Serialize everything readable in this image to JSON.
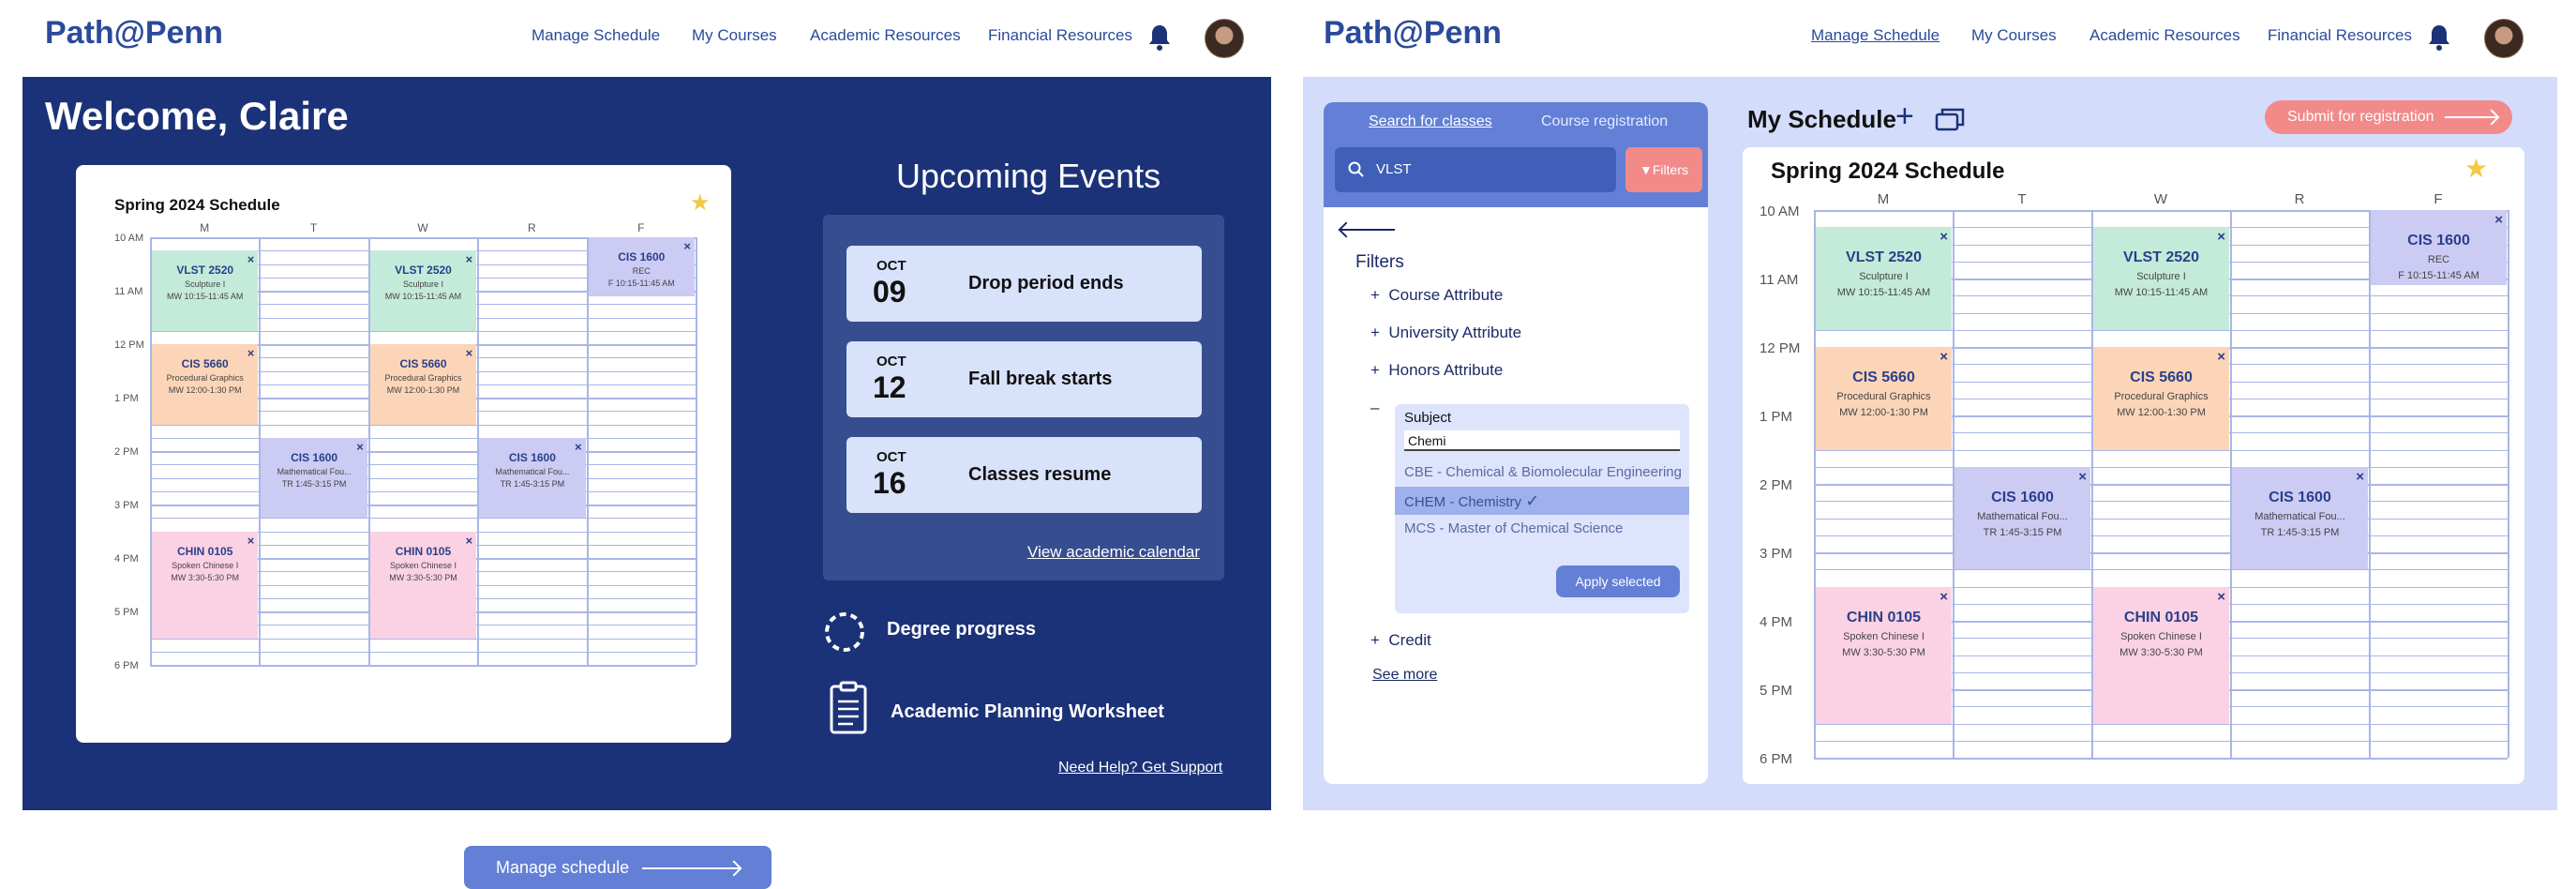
{
  "colors": {
    "navy": "#1c3278",
    "brand": "#2a4a9c",
    "lightblue": "#d3dcfa",
    "accent": "#6380d6",
    "coral": "#f28a8a"
  },
  "header": {
    "logo": "Path@Penn",
    "nav": [
      "Manage Schedule",
      "My Courses",
      "Academic Resources",
      "Financial Resources"
    ],
    "bell_icon": "bell-icon",
    "avatar": "user-avatar"
  },
  "home": {
    "welcome": "Welcome, Claire",
    "schedule": {
      "title": "Spring 2024 Schedule",
      "manage_label": "Manage schedule"
    },
    "upcoming": {
      "title": "Upcoming Events",
      "events": [
        {
          "month": "OCT",
          "day": "09",
          "title": "Drop period ends"
        },
        {
          "month": "OCT",
          "day": "12",
          "title": "Fall break starts"
        },
        {
          "month": "OCT",
          "day": "16",
          "title": "Classes resume"
        }
      ],
      "calendar_link": "View academic calendar"
    },
    "degree_progress": "Degree progress",
    "worksheet": "Academic Planning Worksheet",
    "help_link": "Need Help? Get Support"
  },
  "schedule": {
    "days": [
      "M",
      "T",
      "W",
      "R",
      "F"
    ],
    "times": [
      "10 AM",
      "11 AM",
      "12 PM",
      "1 PM",
      "2 PM",
      "3 PM",
      "4 PM",
      "5 PM",
      "6 PM"
    ],
    "events": [
      {
        "code": "VLST 2520",
        "name": "Sculpture I",
        "time": "MW 10:15-11:45 AM",
        "day": 0,
        "start": 10.25,
        "end": 11.75,
        "color": "g"
      },
      {
        "code": "VLST 2520",
        "name": "Sculpture I",
        "time": "MW 10:15-11:45 AM",
        "day": 2,
        "start": 10.25,
        "end": 11.75,
        "color": "g"
      },
      {
        "code": "CIS 1600",
        "name": "REC",
        "time": "F 10:15-11:45 AM",
        "day": 4,
        "start": 10.0,
        "end": 11.1,
        "color": "p"
      },
      {
        "code": "CIS 5660",
        "name": "Procedural Graphics",
        "time": "MW 12:00-1:30 PM",
        "day": 0,
        "start": 12.0,
        "end": 13.5,
        "color": "o"
      },
      {
        "code": "CIS 5660",
        "name": "Procedural Graphics",
        "time": "MW 12:00-1:30 PM",
        "day": 2,
        "start": 12.0,
        "end": 13.5,
        "color": "o"
      },
      {
        "code": "CIS 1600",
        "name": "Mathematical Fou...",
        "time": "TR 1:45-3:15 PM",
        "day": 1,
        "start": 13.75,
        "end": 15.25,
        "color": "p"
      },
      {
        "code": "CIS 1600",
        "name": "Mathematical Fou...",
        "time": "TR 1:45-3:15 PM",
        "day": 3,
        "start": 13.75,
        "end": 15.25,
        "color": "p"
      },
      {
        "code": "CHIN 0105",
        "name": "Spoken Chinese I",
        "time": "MW 3:30-5:30 PM",
        "day": 0,
        "start": 15.5,
        "end": 17.5,
        "color": "k"
      },
      {
        "code": "CHIN 0105",
        "name": "Spoken Chinese I",
        "time": "MW 3:30-5:30 PM",
        "day": 2,
        "start": 15.5,
        "end": 17.5,
        "color": "k"
      }
    ]
  },
  "manage": {
    "tabs": [
      "Search for classes",
      "Course registration"
    ],
    "search_value": "VLST",
    "filters_btn": "Filters",
    "filters_title": "Filters",
    "attributes": [
      "Course Attribute",
      "University Attribute",
      "Honors Attribute"
    ],
    "subject": {
      "label": "Subject",
      "input": "Chemi",
      "options": [
        "CBE - Chemical & Biomolecular Engineering",
        "CHEM - Chemistry",
        "MCS - Master of Chemical Science"
      ],
      "selected": 1,
      "apply": "Apply selected"
    },
    "credit": "Credit",
    "see_more": "See more",
    "my_schedule": "My Schedule",
    "submit": "Submit for registration",
    "schedule_title": "Spring 2024 Schedule"
  }
}
